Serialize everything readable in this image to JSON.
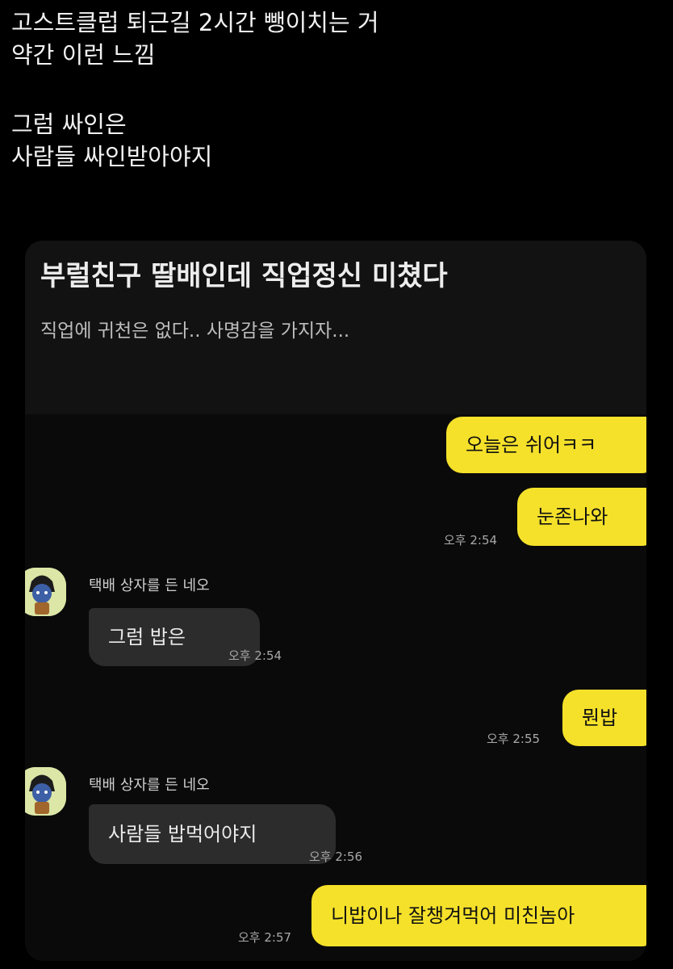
{
  "post": {
    "line1": "고스트클럽 퇴근길 2시간 뺑이치는 거",
    "line2": "약간 이런 느낌",
    "line3": "그럼 싸인은",
    "line4": "사람들 싸인받아야지"
  },
  "card": {
    "title": "부럴친구 딸배인데 직업정신 미쳤다",
    "subtitle": "직업에 귀천은 없다.. 사명감을 가지자..."
  },
  "chat": {
    "sender_name": "택배 상자를 든 네오",
    "messages": [
      {
        "from": "me",
        "text": "오늘은 쉬어ㅋㅋ"
      },
      {
        "from": "me",
        "text": "눈존나와",
        "time": "오후 2:54"
      },
      {
        "from": "other",
        "text": "그럼 밥은",
        "time": "오후 2:54"
      },
      {
        "from": "me",
        "text": "뭔밥",
        "time": "오후 2:55"
      },
      {
        "from": "other",
        "text": "사람들 밥먹어야지",
        "time": "오후 2:56"
      },
      {
        "from": "me",
        "text": "니밥이나 잘챙겨먹어 미친놈아",
        "time": "오후 2:57"
      }
    ]
  },
  "colors": {
    "my_bubble": "#f5e12a",
    "other_bubble": "#2c2c2c",
    "avatar_bg": "#dce6a6"
  },
  "icons": {
    "avatar": "neo-character-avatar"
  }
}
